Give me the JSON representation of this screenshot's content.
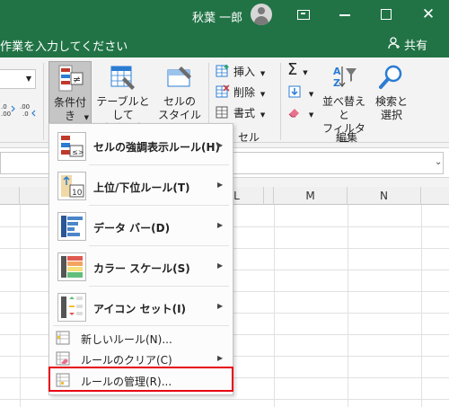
{
  "titlebar": {
    "user_name": "秋葉 一郎",
    "icons": [
      "avatar-icon",
      "ribbon-display-options-icon",
      "minimize-icon",
      "maximize-icon",
      "close-icon"
    ],
    "accent_color": "#217346"
  },
  "tellbar": {
    "tell_me_text": "作業を入力してください",
    "share_label": "共有"
  },
  "ribbon": {
    "number_format": {
      "increase_decimal_label": ".0 .00",
      "decrease_decimal_label": ".00 →.0"
    },
    "styles": {
      "conditional_format": "条件付き\n書式",
      "format_as_table": "テーブルとして\n書式設定",
      "cell_styles": "セルの\nスタイル"
    },
    "cells": {
      "insert": "挿入",
      "delete": "削除",
      "format": "書式",
      "group_label": "セル"
    },
    "editing": {
      "sort_filter": "並べ替えと\nフィルター",
      "find_select": "検索と\n選択",
      "group_label": "編集"
    }
  },
  "grid": {
    "columns": [
      "L",
      "M",
      "N"
    ]
  },
  "cf_menu": {
    "items": [
      {
        "label": "セルの強調表示ルール(H)",
        "has_submenu": true,
        "icon": "highlight-cells-rules-icon"
      },
      {
        "label": "上位/下位ルール(T)",
        "has_submenu": true,
        "icon": "top-bottom-rules-icon"
      },
      {
        "label": "データ バー(D)",
        "has_submenu": true,
        "icon": "data-bars-icon"
      },
      {
        "label": "カラー スケール(S)",
        "has_submenu": true,
        "icon": "color-scales-icon"
      },
      {
        "label": "アイコン セット(I)",
        "has_submenu": true,
        "icon": "icon-sets-icon"
      }
    ],
    "small_items": [
      {
        "label": "新しいルール(N)...",
        "has_submenu": false,
        "icon": "new-rule-icon"
      },
      {
        "label": "ルールのクリア(C)",
        "has_submenu": true,
        "icon": "clear-rules-icon"
      },
      {
        "label": "ルールの管理(R)...",
        "has_submenu": false,
        "icon": "manage-rules-icon"
      }
    ],
    "highlight_color": "#e60012"
  }
}
